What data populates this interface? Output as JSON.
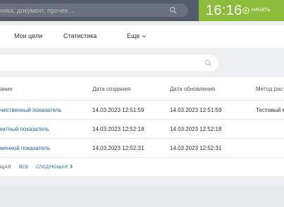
{
  "topbar": {
    "search_placeholder": "ника, документ, прочее....",
    "clock": "16:16",
    "start_label": "НАЧАТЬ",
    "colors": {
      "bar": "#535c69",
      "clock_panel": "#8dbb3b"
    }
  },
  "nav": {
    "items": [
      {
        "label": "Мои цели"
      },
      {
        "label": "Статистика"
      },
      {
        "label": "Еще"
      }
    ]
  },
  "filter": {
    "icon": "search-icon"
  },
  "table": {
    "headers": [
      "ание",
      "Дата создания",
      "Дата обновления",
      "Метод рас"
    ],
    "rows": [
      {
        "name": "чественный показатель",
        "created": "14.03.2023 12:51:59",
        "updated": "14.03.2023 12:51:59",
        "method": "Тестовый м"
      },
      {
        "name": "ектный показатель",
        "created": "14.03.2023 12:52:18",
        "updated": "14.03.2023 12:52:18",
        "method": ""
      },
      {
        "name": "менной показатель",
        "created": "14.03.2023 12:52:31",
        "updated": "14.03.2023 12:52:31",
        "method": ""
      }
    ]
  },
  "pager": {
    "prev": "ЩАЯ",
    "all": "ВСЕ",
    "next": "СЛЕДУЮЩАЯ"
  }
}
